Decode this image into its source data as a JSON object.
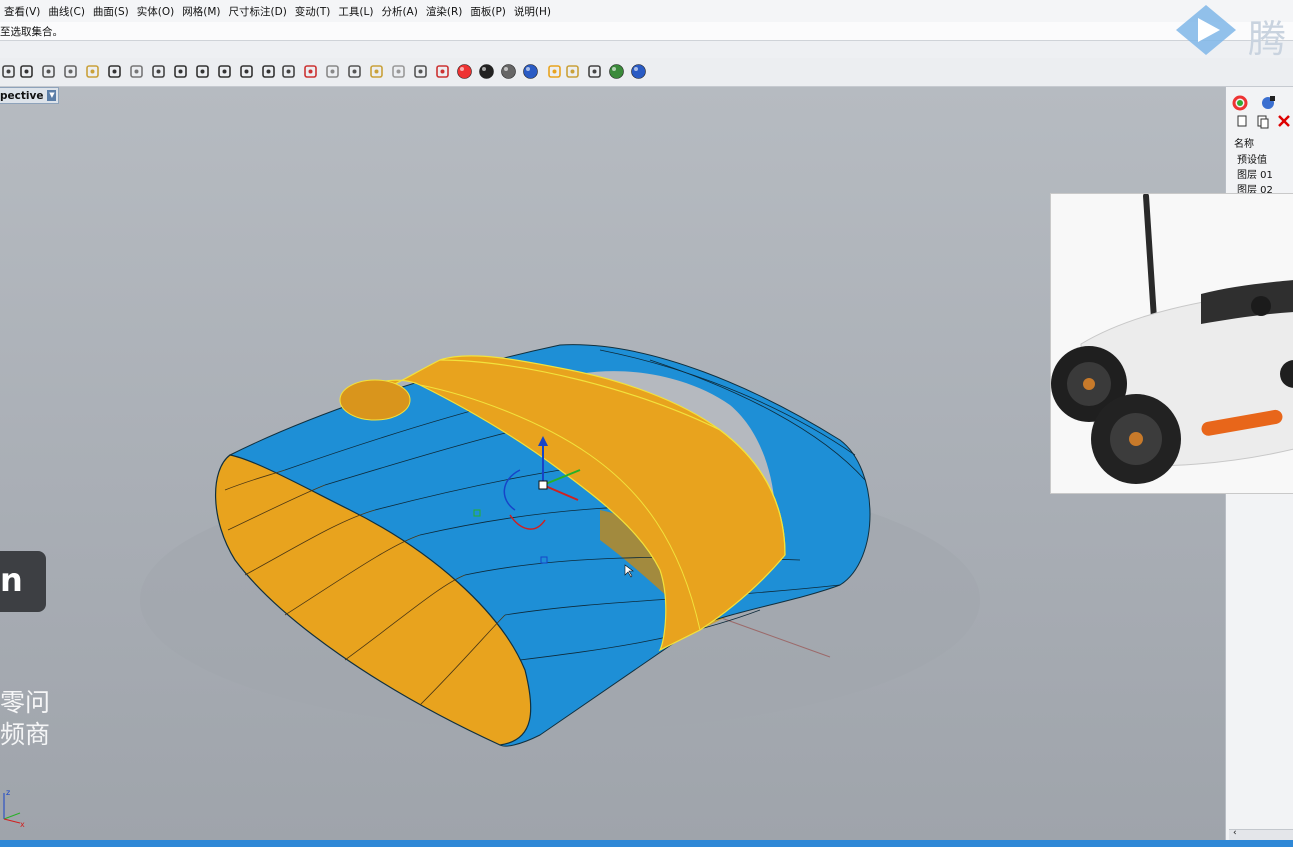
{
  "menubar": {
    "items": [
      "查看(V)",
      "曲线(C)",
      "曲面(S)",
      "实体(O)",
      "网格(M)",
      "尺寸标注(D)",
      "变动(T)",
      "工具(L)",
      "分析(A)",
      "渲染(R)",
      "面板(P)",
      "说明(H)"
    ]
  },
  "command_line": {
    "text": "至选取集合。"
  },
  "toolbar": {
    "icons": [
      "print-icon",
      "new-file-icon",
      "cut-icon",
      "copy-icon",
      "paste-icon",
      "undo-icon",
      "pan-icon",
      "rotate-icon",
      "zoom-icon",
      "zoom-window-icon",
      "zoom-extents-icon",
      "zoom-selected-icon",
      "view-rotate-icon",
      "grid-icon",
      "car-icon",
      "mouse-icon",
      "curve-icon",
      "points-icon",
      "light-icon",
      "lock-icon",
      "render-icon",
      "color-wheel-icon",
      "sphere-dark-icon",
      "sphere-gray-icon",
      "sphere-blue-icon",
      "flag-icon",
      "gear-icon",
      "snap-icon",
      "globe-icon",
      "help-icon"
    ]
  },
  "viewport": {
    "label": "pective"
  },
  "overlay": {
    "pill_text": "n",
    "watermark_line1": "零问",
    "watermark_line2": "频商"
  },
  "axis": {
    "z": "z",
    "x": "x"
  },
  "layers_panel": {
    "header": "名称",
    "rows": [
      "预设值",
      "图层 01",
      "图层 02"
    ]
  },
  "logo": {
    "text": "腾"
  },
  "colors": {
    "blue_surface": "#1e8fd6",
    "yellow_surface": "#e8a31e",
    "highlight": "#f2e23c"
  }
}
